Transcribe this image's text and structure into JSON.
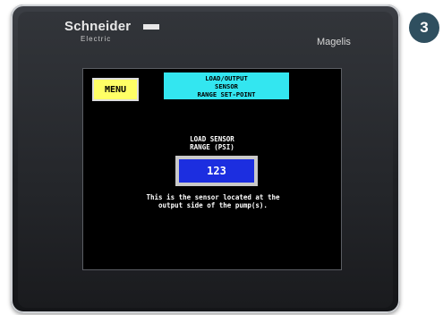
{
  "device": {
    "brand": "Schneider",
    "brand_sub": "Electric",
    "product": "Magelis"
  },
  "screen": {
    "menu_label": "MENU",
    "title_lines": [
      "LOAD/OUTPUT",
      "SENSOR",
      "RANGE SET-POINT"
    ],
    "field_label_lines": [
      "LOAD SENSOR",
      "RANGE (PSI)"
    ],
    "value": "123",
    "description_lines": [
      "This is the sensor located at the",
      "output side of the pump(s)."
    ]
  },
  "step_badge": "3",
  "colors": {
    "menu_button": "#ffff66",
    "title_box": "#33e6f0",
    "value_field": "#1c2ee0",
    "badge": "#2f4f5f"
  }
}
